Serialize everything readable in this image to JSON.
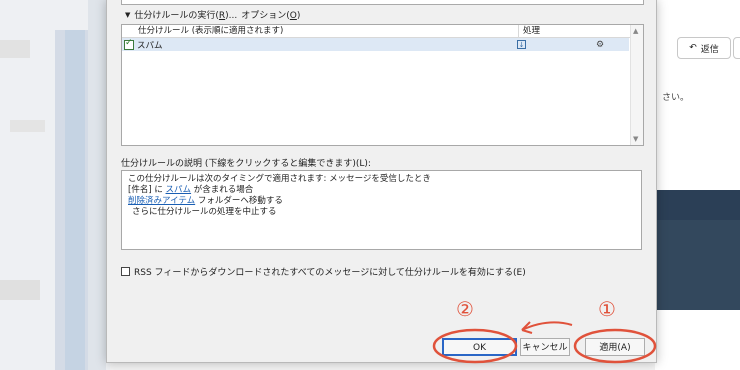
{
  "background": {
    "reply_label": "返信",
    "fragment_text": "さい。"
  },
  "dialog": {
    "run_rules": {
      "prefix": "仕分けルールの実行(",
      "key": "R",
      "suffix": ")...",
      "options_prefix": "オプション(",
      "options_key": "O",
      "options_suffix": ")"
    },
    "rules_table": {
      "col_rule": "仕分けルール (表示順に適用されます)",
      "col_action": "処理",
      "rows": [
        {
          "name": "スパム",
          "enabled": true
        }
      ]
    },
    "description_label": "仕分けルールの説明 (下線をクリックすると編集できます)(L):",
    "description": {
      "line1": "この仕分けルールは次のタイミングで適用されます: メッセージを受信したとき",
      "line2_a": "[件名] に ",
      "line2_link": "スパム",
      "line2_b": " が含まれる場合",
      "line3_link": "削除済みアイテム",
      "line3_b": " フォルダーへ移動する",
      "line4": "さらに仕分けルールの処理を中止する"
    },
    "rss_label": "RSS フィードからダウンロードされたすべてのメッセージに対して仕分けルールを有効にする(E)",
    "buttons": {
      "ok": "OK",
      "cancel": "キャンセル",
      "apply": "適用(A)"
    }
  },
  "annotations": {
    "num1": "①",
    "num2": "②"
  },
  "colors": {
    "annotation": "#e0523b",
    "link": "#1a5fb4",
    "selected_row": "#dde8f5"
  }
}
